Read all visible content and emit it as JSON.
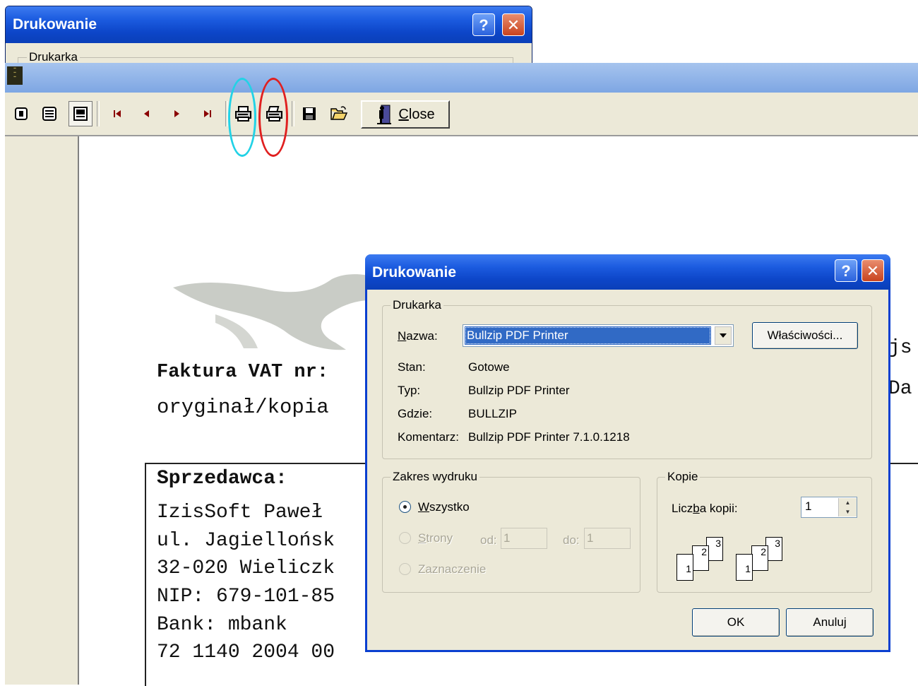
{
  "background_dialog": {
    "title": "Drukowanie",
    "group_label": "Drukarka"
  },
  "preview_window": {
    "toolbar": {
      "buttons": [
        {
          "name": "one-page-view",
          "icon": "single-page-icon"
        },
        {
          "name": "page-width-view",
          "icon": "page-lines-icon"
        },
        {
          "name": "zoom-view",
          "icon": "zoom-page-icon"
        },
        {
          "name": "first-page",
          "icon": "first-page-icon"
        },
        {
          "name": "previous-page",
          "icon": "prev-page-icon"
        },
        {
          "name": "next-page",
          "icon": "next-page-icon"
        },
        {
          "name": "last-page",
          "icon": "last-page-icon"
        },
        {
          "name": "print-setup",
          "icon": "printer-icon"
        },
        {
          "name": "print",
          "icon": "printer-icon"
        },
        {
          "name": "save",
          "icon": "floppy-disk-icon"
        },
        {
          "name": "open",
          "icon": "open-folder-icon"
        }
      ],
      "close_label": "Close"
    },
    "document": {
      "invoice_title": "Faktura VAT nr:",
      "copy_label": "oryginał/kopia",
      "seller_heading": "Sprzedawca:",
      "seller_lines": [
        "IzisSoft Paweł",
        "ul. Jagiellońsk",
        "32-020 Wieliczk",
        "NIP: 679-101-85",
        "Bank: mbank",
        "72 1140 2004 00"
      ],
      "right_fragment_1": "js",
      "right_fragment_2": "Da"
    }
  },
  "print_dialog": {
    "title": "Drukowanie",
    "printer_group": {
      "label": "Drukarka",
      "name_label": "Nazwa:",
      "name_label_hotkey": "N",
      "name_label_rest": "azwa:",
      "selected_printer": "Bullzip PDF Printer",
      "properties_button": "Właściwości...",
      "info": [
        {
          "key": "Stan:",
          "value": "Gotowe"
        },
        {
          "key": "Typ:",
          "value": "Bullzip PDF Printer"
        },
        {
          "key": "Gdzie:",
          "value": "BULLZIP"
        },
        {
          "key": "Komentarz:",
          "value": "Bullzip PDF Printer 7.1.0.1218"
        }
      ]
    },
    "range_group": {
      "label": "Zakres wydruku",
      "all_hotkey": "W",
      "all_rest": "szystko",
      "pages_hotkey": "S",
      "pages_rest": "trony",
      "from_label": "od:",
      "from_value": "1",
      "to_label": "do:",
      "to_value": "1",
      "selection_label": "Zaznaczenie",
      "selected": "Wszystko"
    },
    "copies_group": {
      "label": "Kopie",
      "count_label_pre": "Licz",
      "count_label_hotkey": "b",
      "count_label_post": "a kopii:",
      "count_value": "1",
      "collate_pages": [
        "1",
        "2",
        "3"
      ]
    },
    "ok_label": "OK",
    "cancel_label": "Anuluj"
  },
  "colors": {
    "title_bar": "#0d46c9",
    "annotation_cyan": "#22d2e6",
    "annotation_red": "#e02020",
    "selection": "#316ac5"
  }
}
